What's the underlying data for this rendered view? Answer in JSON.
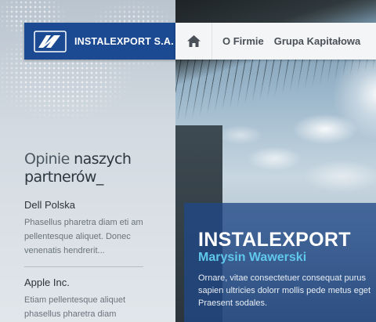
{
  "brand": {
    "name": "INSTALEXPORT S.A."
  },
  "nav": {
    "items": [
      {
        "label": "O Firmie"
      },
      {
        "label": "Grupa Kapitałowa"
      }
    ]
  },
  "opinions": {
    "heading_part1": "Opinie",
    "heading_part2": "naszych partnerów_",
    "reviews": [
      {
        "name": "Dell Polska",
        "text": "Phasellus pharetra diam eti am pellentesque aliquet. Donec venenatis hendrerit..."
      },
      {
        "name": "Apple Inc.",
        "text": "Etiam pellentesque aliquet phasellus pharetra diam"
      }
    ]
  },
  "hero": {
    "title": "INSTALEXPORT",
    "subtitle": "Marysin Wawerski",
    "description": "Ornare, vitae consectetuer consequat purus sapien ultricies dolorr mollis pede metus eget Praesent sodales."
  },
  "colors": {
    "brand_blue": "#1b4a92",
    "caption_blue": "#204887",
    "accent_cyan": "#5fc8ec"
  }
}
